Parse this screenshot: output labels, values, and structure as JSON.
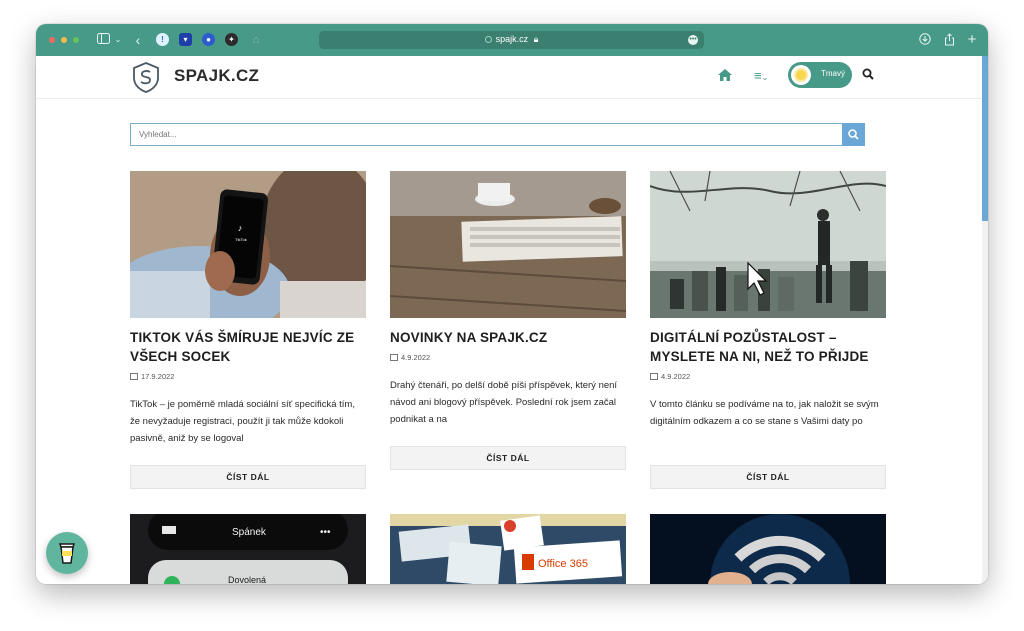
{
  "browser": {
    "url": "spajk.cz"
  },
  "site": {
    "title": "SPAJK.CZ",
    "theme_toggle_label": "Tmavý",
    "search_placeholder": "Vyhledat..."
  },
  "posts": [
    {
      "title": "TIKTOK VÁS ŠMÍRUJE NEJVÍC ZE VŠECH SOCEK",
      "date": "17.9.2022",
      "excerpt": "TikTok – je poměrně mladá sociální síť specifická tím, že nevyžaduje registraci, použít ji tak může kdokoli pasivně, aniž by se logoval",
      "read_more": "ČÍST DÁL"
    },
    {
      "title": "NOVINKY NA SPAJK.CZ",
      "date": "4.9.2022",
      "excerpt": "Drahý čtenáři, po delší době píši příspěvek, který není návod ani blogový příspěvek. Poslední rok jsem začal podnikat a na",
      "read_more": "ČÍST DÁL"
    },
    {
      "title": "DIGITÁLNÍ POZŮSTALOST – MYSLETE NA NI, NEŽ TO PŘIJDE",
      "date": "4.9.2022",
      "excerpt": "V tomto článku se podíváme na to, jak naložit se svým digitálním odkazem a co se stane s Vašimi daty po",
      "read_more": "ČÍST DÁL"
    }
  ],
  "thumb_texts": {
    "tiktok_logo": "TikTok",
    "sleep_label": "Spánek",
    "sleep_more": "•••",
    "vacation_label": "Dovolená",
    "office_label": "Office 365"
  },
  "colors": {
    "accent": "#479a88",
    "search_button": "#6aa7d6"
  }
}
